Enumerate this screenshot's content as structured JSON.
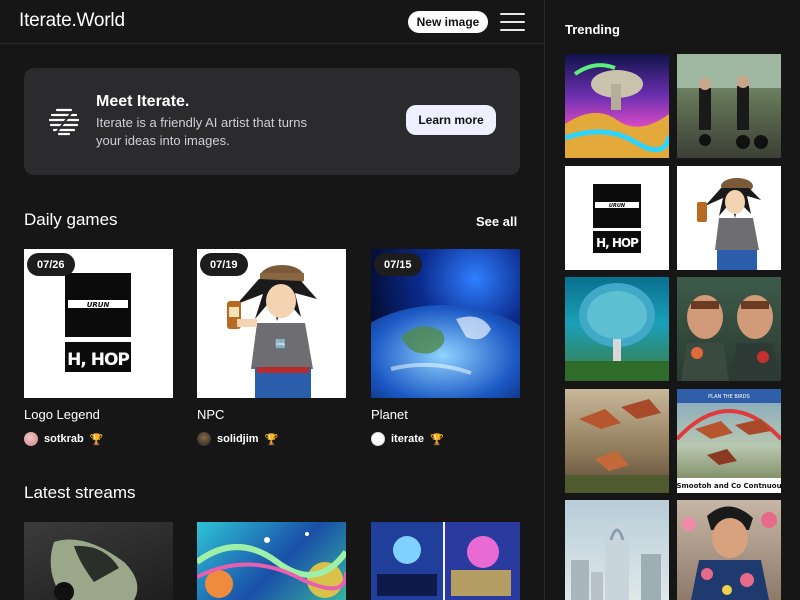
{
  "header": {
    "logo": "Iterate.World",
    "new_image_label": "New image"
  },
  "meet": {
    "title": "Meet Iterate.",
    "description": "Iterate is a friendly AI artist that turns your ideas into images.",
    "learn_more_label": "Learn more"
  },
  "daily_games": {
    "title": "Daily games",
    "see_all_label": "See all",
    "items": [
      {
        "date": "07/26",
        "title": "Logo Legend",
        "user": "sotkrab",
        "logo_top": "URUN",
        "logo_bottom": "H, HOP"
      },
      {
        "date": "07/19",
        "title": "NPC",
        "user": "solidjim"
      },
      {
        "date": "07/15",
        "title": "Planet",
        "user": "iterate"
      }
    ]
  },
  "latest_streams": {
    "title": "Latest streams"
  },
  "trending": {
    "title": "Trending",
    "logo_top": "URUN",
    "logo_bottom": "H, HOP",
    "birds_caption": "Smootoh and Co Contnuou",
    "birds_banner": "PLAN THE BIRDS"
  },
  "colors": {
    "background": "#161616",
    "card": "#2b2b2d",
    "accent_button": "#eef0ff",
    "trophy": "#f5c542"
  },
  "icons": [
    "hamburger-menu-icon",
    "iterate-logo-icon",
    "trophy-icon"
  ]
}
